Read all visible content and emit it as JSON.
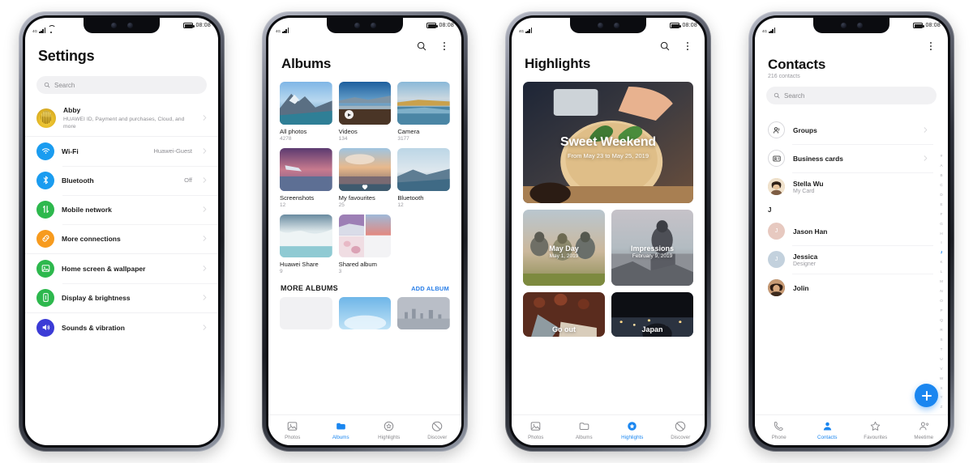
{
  "status_bar": {
    "time": "08:08",
    "signal_label": "4G",
    "icons": [
      "signal-bars",
      "wifi",
      "battery"
    ]
  },
  "colors": {
    "accent": "#1a86f0",
    "link": "#2a7fe8",
    "muted": "#8e8e93"
  },
  "phones": [
    {
      "id": "settings",
      "screen": {
        "title": "Settings",
        "search": {
          "placeholder": "Search"
        },
        "groups": [
          {
            "rows": [
              {
                "name": "Abby",
                "subtitle": "HUAWEI ID, Payment and purchases, Cloud, and more",
                "icon": "user-avatar",
                "chevron": true
              }
            ]
          },
          {
            "rows": [
              {
                "name": "Wi-Fi",
                "value": "Huawei-Guest",
                "icon": "wifi-icon",
                "color": "#1a9cf0",
                "chevron": true
              },
              {
                "name": "Bluetooth",
                "value": "Off",
                "icon": "bluetooth-icon",
                "color": "#1a9cf0",
                "chevron": true
              },
              {
                "name": "Mobile network",
                "value": "",
                "icon": "mobile-network-icon",
                "color": "#2db84d",
                "chevron": true
              },
              {
                "name": "More connections",
                "value": "",
                "icon": "link-icon",
                "color": "#f79b1e",
                "chevron": true
              }
            ]
          },
          {
            "rows": [
              {
                "name": "Home screen & wallpaper",
                "value": "",
                "icon": "image-icon",
                "color": "#2db84d",
                "chevron": true
              },
              {
                "name": "Display & brightness",
                "value": "",
                "icon": "display-icon",
                "color": "#2db84d",
                "chevron": true
              }
            ]
          },
          {
            "rows": [
              {
                "name": "Sounds & vibration",
                "value": "",
                "icon": "speaker-icon",
                "color": "#3b3bd6",
                "chevron": true
              }
            ]
          }
        ]
      }
    },
    {
      "id": "albums",
      "screen": {
        "title": "Albums",
        "topbar_icons": [
          "search-icon",
          "more-vertical-icon"
        ],
        "albums": [
          {
            "name": "All photos",
            "count": "4278",
            "badge": ""
          },
          {
            "name": "Videos",
            "count": "134",
            "badge": "play"
          },
          {
            "name": "Camera",
            "count": "3177",
            "badge": ""
          },
          {
            "name": "Screenshots",
            "count": "12",
            "badge": ""
          },
          {
            "name": "My favourites",
            "count": "25",
            "badge": "heart"
          },
          {
            "name": "Bluetooth",
            "count": "12",
            "badge": ""
          },
          {
            "name": "Huawei Share",
            "count": "9",
            "badge": ""
          },
          {
            "name": "Shared album",
            "count": "3",
            "badge": "mosaic"
          }
        ],
        "more_albums": {
          "title": "MORE ALBUMS",
          "action": "ADD ALBUM"
        },
        "nav": [
          {
            "label": "Photos",
            "icon": "photos-icon",
            "active": false
          },
          {
            "label": "Albums",
            "icon": "albums-icon",
            "active": true
          },
          {
            "label": "Highlights",
            "icon": "highlights-icon",
            "active": false
          },
          {
            "label": "Discover",
            "icon": "discover-icon",
            "active": false
          }
        ]
      }
    },
    {
      "id": "highlights",
      "screen": {
        "title": "Highlights",
        "topbar_icons": [
          "search-icon",
          "more-vertical-icon"
        ],
        "hero": {
          "title": "Sweet Weekend",
          "subtitle": "From May 23 to May 25, 2019"
        },
        "cards": [
          {
            "title": "May Day",
            "date": "May 1, 2019"
          },
          {
            "title": "Impressions",
            "date": "February 9, 2019"
          },
          {
            "title": "Go out",
            "date": ""
          },
          {
            "title": "Japan",
            "date": ""
          }
        ],
        "nav": [
          {
            "label": "Photos",
            "icon": "photos-icon",
            "active": false
          },
          {
            "label": "Albums",
            "icon": "albums-icon",
            "active": false
          },
          {
            "label": "Highlights",
            "icon": "highlights-icon",
            "active": true
          },
          {
            "label": "Discover",
            "icon": "discover-icon",
            "active": false
          }
        ]
      }
    },
    {
      "id": "contacts",
      "screen": {
        "title": "Contacts",
        "subtitle": "216 contacts",
        "topbar_icons": [
          "more-vertical-icon"
        ],
        "search": {
          "placeholder": "Search"
        },
        "shortcuts": [
          {
            "label": "Groups",
            "icon": "groups-icon",
            "chevron": true
          },
          {
            "label": "Business cards",
            "icon": "business-card-icon",
            "chevron": true
          }
        ],
        "my_card": {
          "name": "Stella Wu",
          "subtitle": "My Card"
        },
        "section": "J",
        "contacts": [
          {
            "name": "Jason Han",
            "subtitle": "",
            "initial": "J",
            "avatar_color": "#e7c9c0"
          },
          {
            "name": "Jessica",
            "subtitle": "Designer",
            "initial": "J",
            "avatar_color": "#c3d1dd"
          },
          {
            "name": "Jolin",
            "subtitle": "",
            "initial": "",
            "avatar_color": "#8a6a52"
          }
        ],
        "alpha_index": [
          "#",
          "A",
          "B",
          "C",
          "D",
          "E",
          "F",
          "G",
          "H",
          "I",
          "J",
          "K",
          "L",
          "M",
          "N",
          "O",
          "P",
          "Q",
          "R",
          "S",
          "T",
          "U",
          "V",
          "W",
          "X",
          "Y",
          "Z"
        ],
        "alpha_active": "J",
        "fab": {
          "icon": "plus-icon",
          "label": ""
        },
        "nav": [
          {
            "label": "Phone",
            "icon": "phone-icon",
            "active": false
          },
          {
            "label": "Contacts",
            "icon": "contacts-icon",
            "active": true
          },
          {
            "label": "Favourites",
            "icon": "star-icon",
            "active": false
          },
          {
            "label": "Meetime",
            "icon": "meetime-icon",
            "active": false
          }
        ]
      }
    }
  ]
}
